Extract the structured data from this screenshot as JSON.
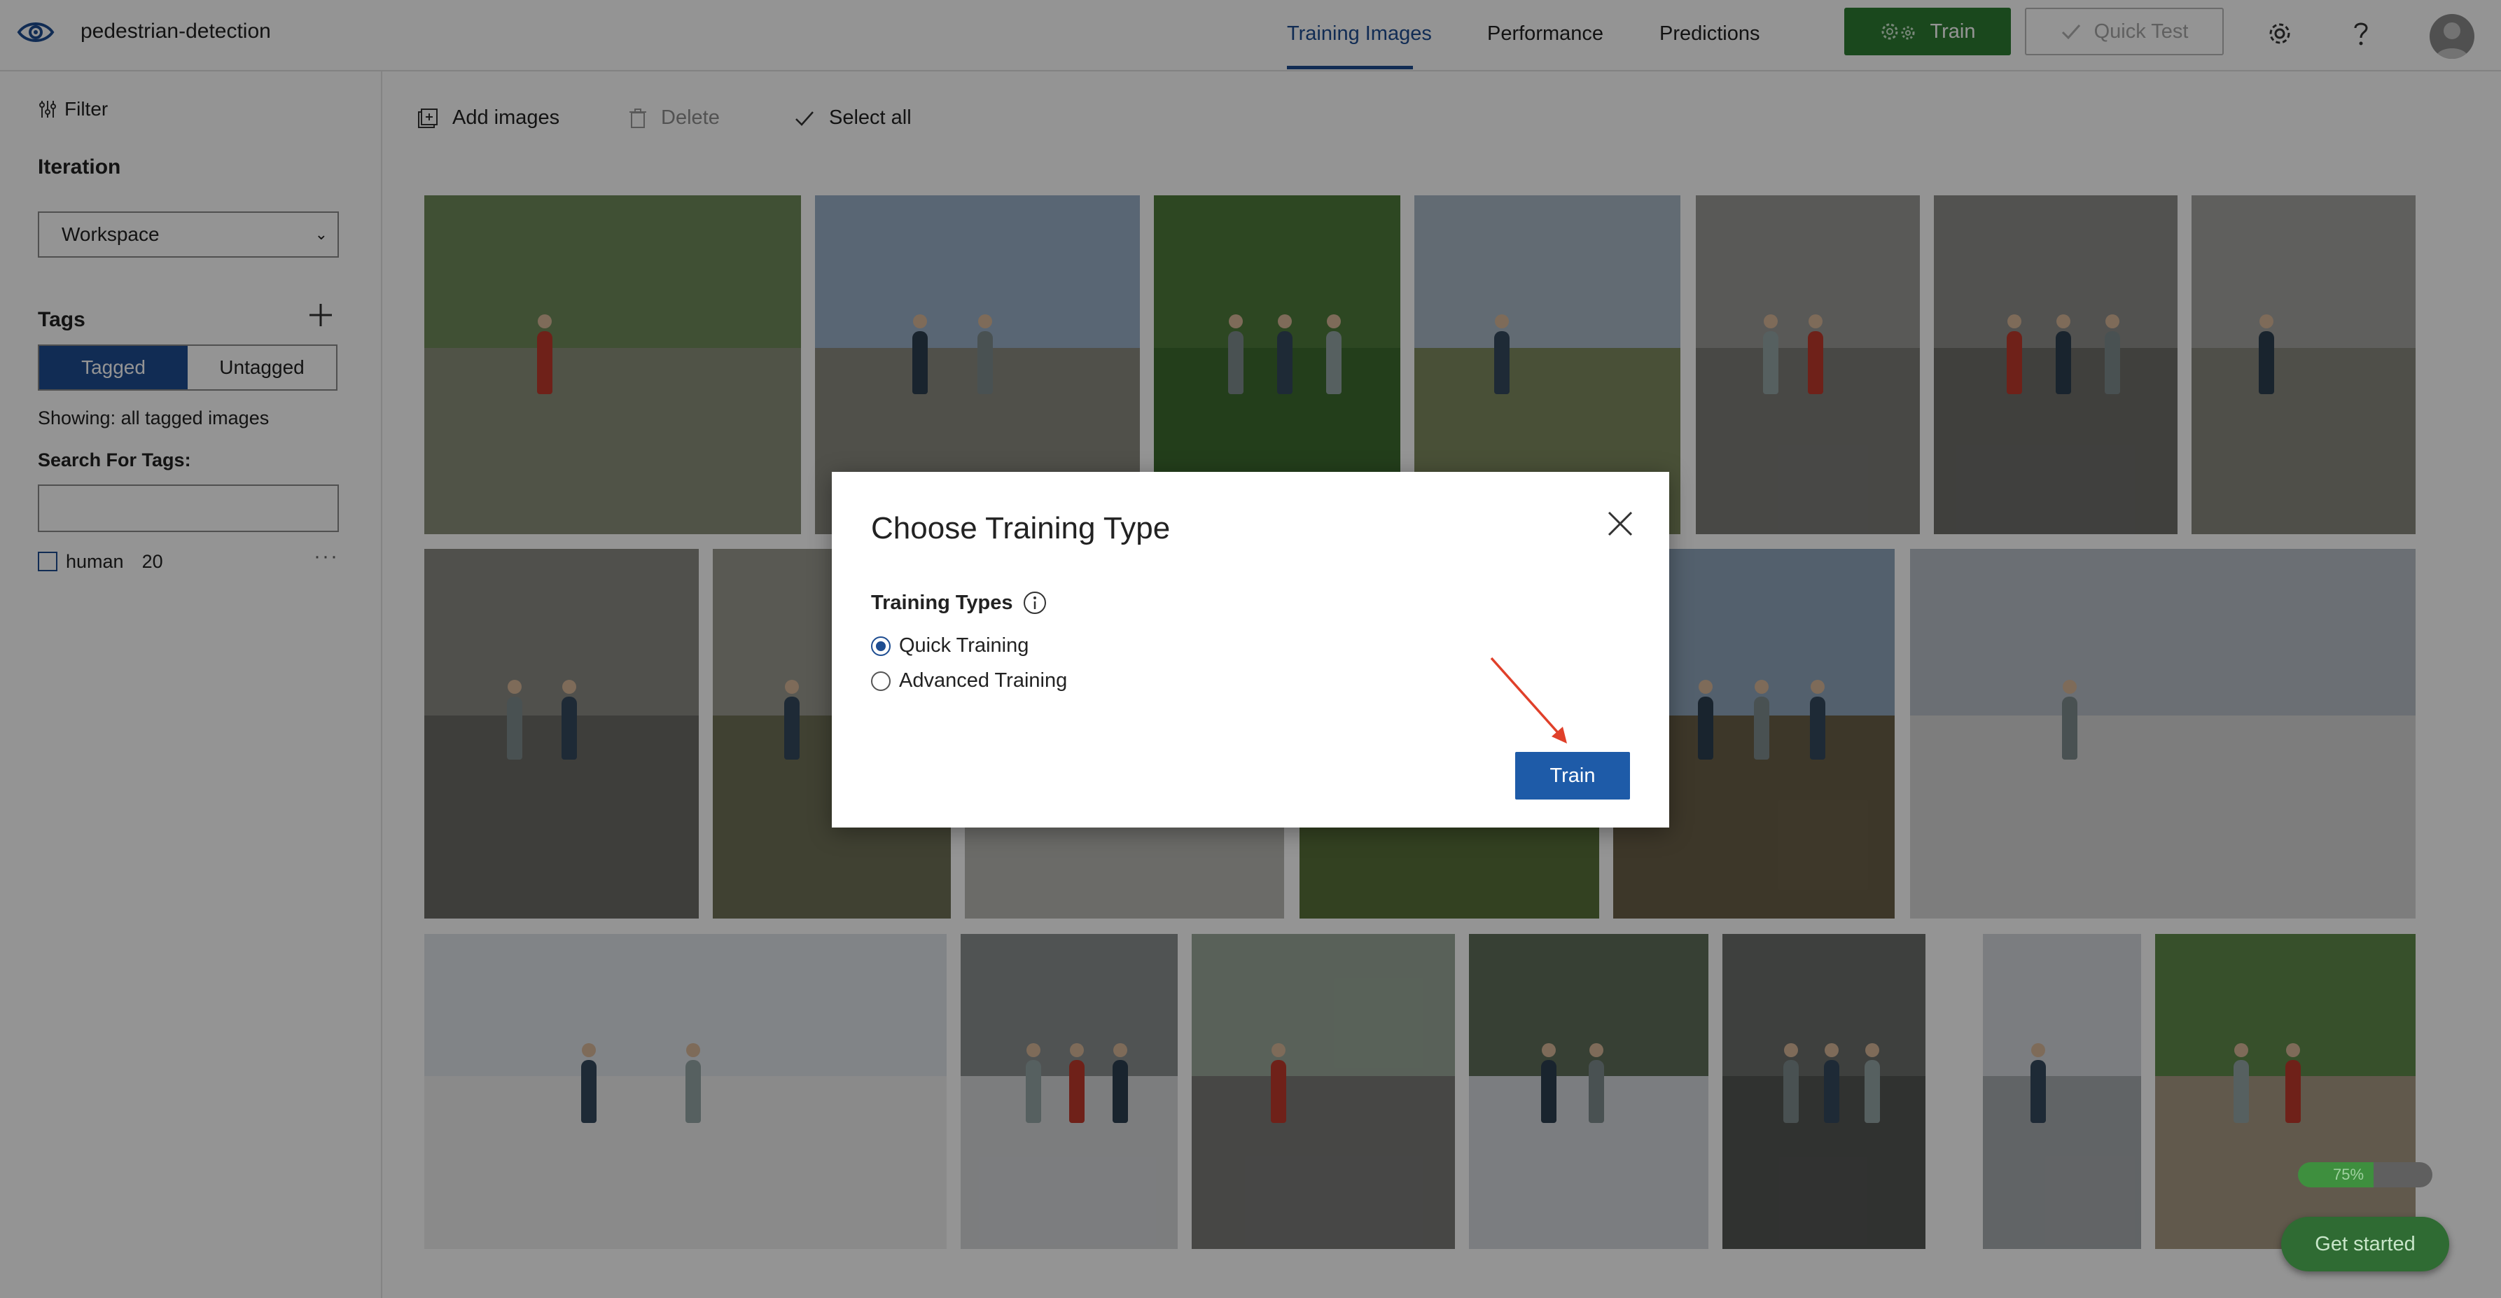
{
  "header": {
    "project_name": "pedestrian-detection",
    "tabs": [
      "Training Images",
      "Performance",
      "Predictions"
    ],
    "active_tab": "Training Images",
    "train_label": "Train",
    "quick_test_label": "Quick Test"
  },
  "sidebar": {
    "filter_label": "Filter",
    "iteration_label": "Iteration",
    "iteration_value": "Workspace",
    "tags_label": "Tags",
    "tagged_label": "Tagged",
    "untagged_label": "Untagged",
    "showing_text": "Showing: all tagged images",
    "search_label": "Search For Tags:",
    "search_value": "",
    "tags": [
      {
        "name": "human",
        "count": "20"
      }
    ]
  },
  "toolbar": {
    "add_images": "Add images",
    "delete": "Delete",
    "select_all": "Select all"
  },
  "modal": {
    "title": "Choose Training Type",
    "training_types_label": "Training Types",
    "options": [
      "Quick Training",
      "Advanced Training"
    ],
    "selected": "Quick Training",
    "train_button": "Train"
  },
  "footer": {
    "progress_text": "75%",
    "progress": 0.75,
    "get_started": "Get started"
  },
  "colors": {
    "accent": "#1e4d91",
    "train_green": "#2e7d32",
    "annotation_arrow": "#e0402a"
  },
  "icons": [
    "eye-logo-icon",
    "settings-icon",
    "help-icon",
    "filter-icon",
    "plus-icon",
    "add-images-icon",
    "trash-icon",
    "check-icon",
    "close-icon",
    "info-icon",
    "gears-icon"
  ]
}
